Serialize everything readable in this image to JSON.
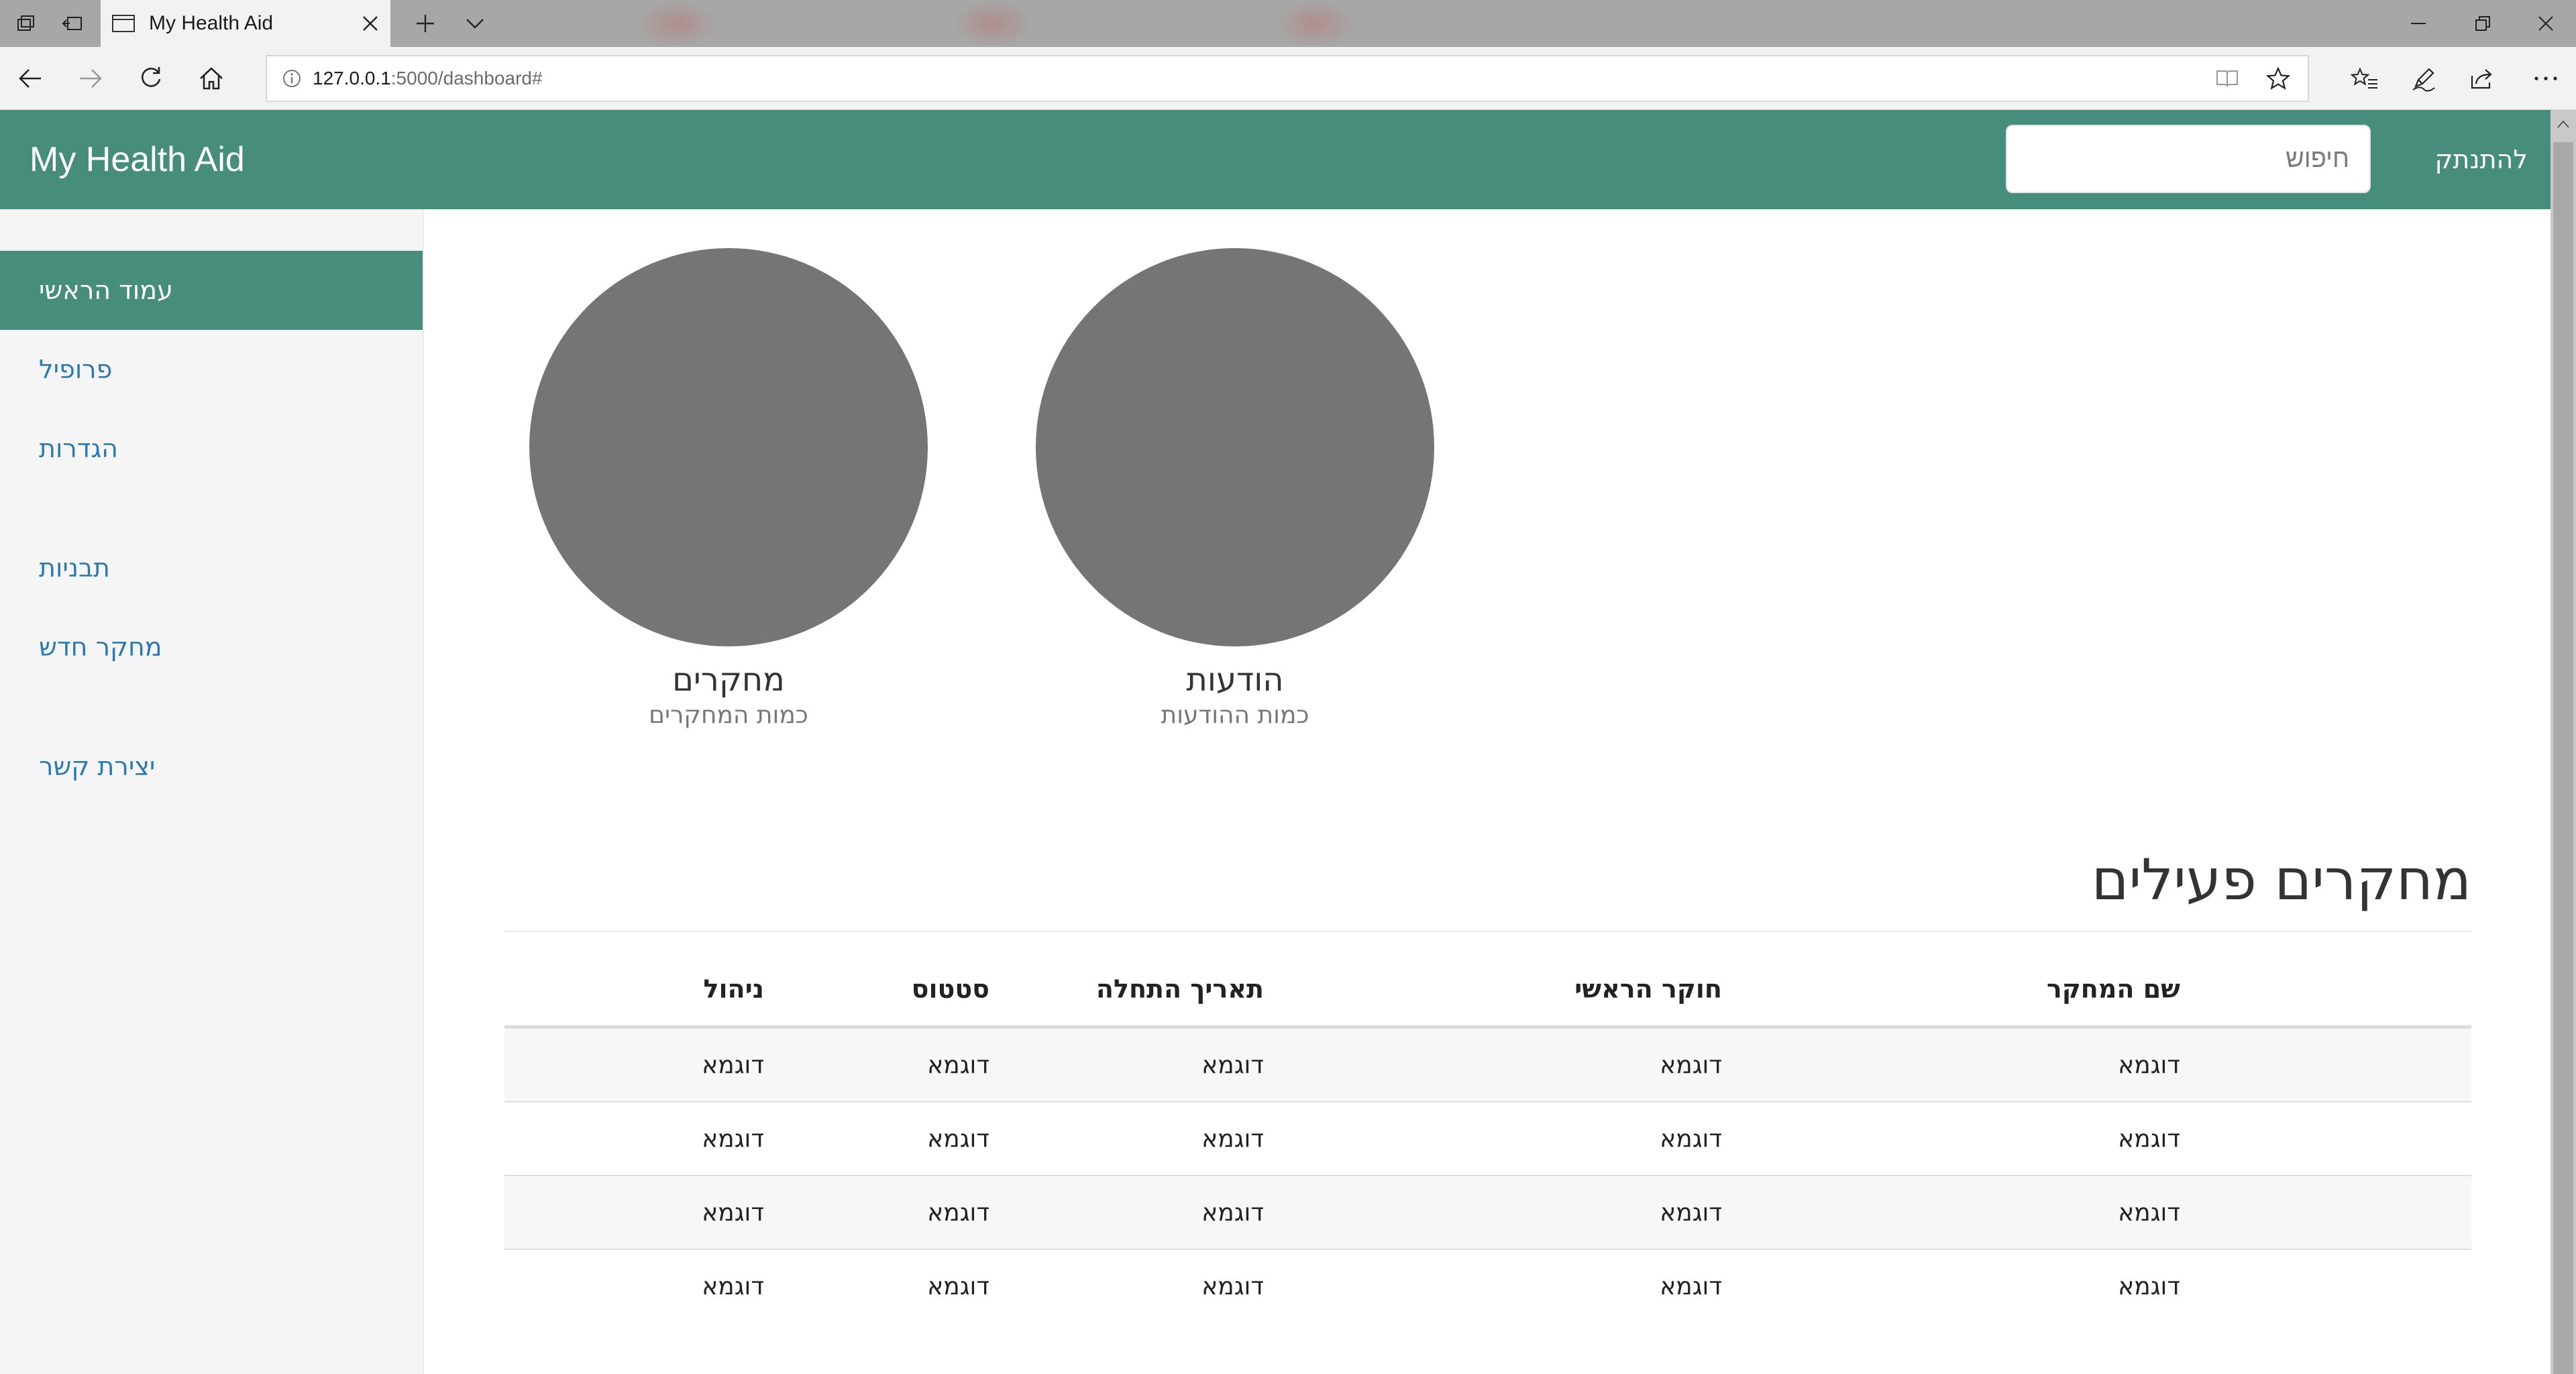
{
  "browser": {
    "tab_title": "My Health Aid",
    "url_host": "127.0.0.1",
    "url_rest": ":5000/dashboard#"
  },
  "app": {
    "brand": "My Health Aid",
    "search_placeholder": "חיפוש",
    "signout": "להתנתק",
    "accent_color": "#468d7b",
    "link_color": "#2c7ab3"
  },
  "sidebar": {
    "items": [
      {
        "label": "עמוד הראשי",
        "active": true
      },
      {
        "label": "פרופיל"
      },
      {
        "label": "הגדרות"
      },
      {
        "label": "תבניות"
      },
      {
        "label": "מחקר חדש"
      },
      {
        "label": "יצירת קשר"
      }
    ]
  },
  "stats": [
    {
      "title": "מחקרים",
      "subtitle": "כמות המחקרים"
    },
    {
      "title": "הודעות",
      "subtitle": "כמות ההודעות"
    }
  ],
  "table": {
    "title": "מחקרים פעילים",
    "headers": [
      "שם המחקר",
      "חוקר הראשי",
      "תאריך התחלה",
      "סטטוס",
      "ניהול"
    ],
    "rows": [
      [
        "דוגמא",
        "דוגמא",
        "דוגמא",
        "דוגמא",
        "דוגמא"
      ],
      [
        "דוגמא",
        "דוגמא",
        "דוגמא",
        "דוגמא",
        "דוגמא"
      ],
      [
        "דוגמא",
        "דוגמא",
        "דוגמא",
        "דוגמא",
        "דוגמא"
      ],
      [
        "דוגמא",
        "דוגמא",
        "דוגמא",
        "דוגמא",
        "דוגמא"
      ]
    ]
  }
}
